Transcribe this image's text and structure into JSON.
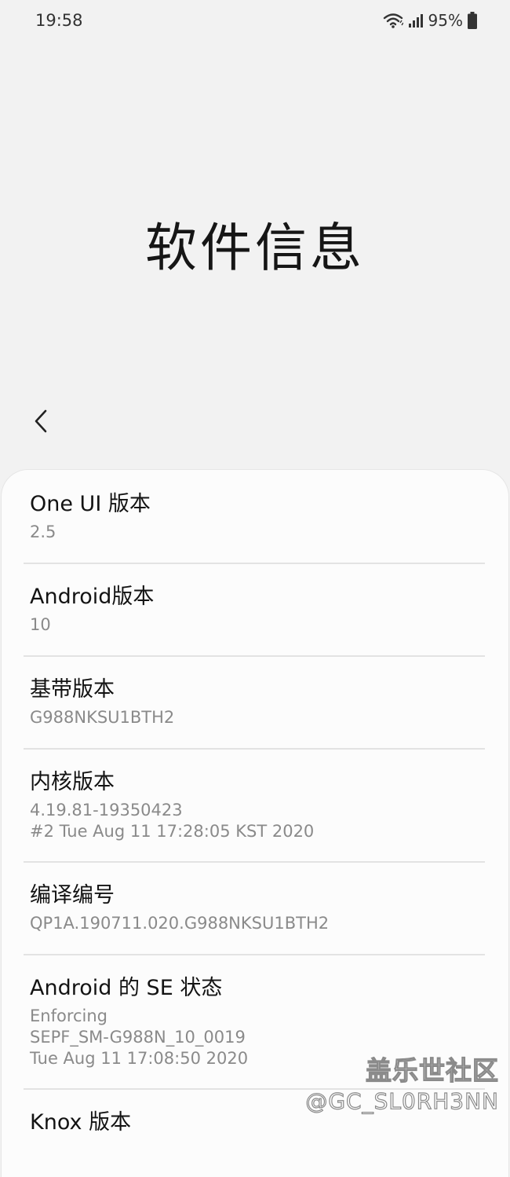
{
  "status_bar": {
    "time": "19:58",
    "battery": "95%",
    "icons": [
      "wifi-icon",
      "signal-icon",
      "battery-icon"
    ]
  },
  "page": {
    "title": "软件信息"
  },
  "items": [
    {
      "title": "One UI 版本",
      "values": [
        "2.5"
      ]
    },
    {
      "title": "Android版本",
      "values": [
        "10"
      ]
    },
    {
      "title": "基带版本",
      "values": [
        "G988NKSU1BTH2"
      ]
    },
    {
      "title": "内核版本",
      "values": [
        "4.19.81-19350423",
        "#2 Tue Aug 11 17:28:05 KST 2020"
      ]
    },
    {
      "title": "编译编号",
      "values": [
        "QP1A.190711.020.G988NKSU1BTH2"
      ]
    },
    {
      "title": "Android 的 SE 状态",
      "values": [
        "Enforcing",
        "SEPF_SM-G988N_10_0019",
        "Tue Aug 11 17:08:50 2020"
      ]
    },
    {
      "title": "Knox 版本",
      "values": []
    }
  ],
  "watermark": {
    "line1": "盖乐世社区",
    "line2": "@GC_SL0RH3NN"
  }
}
